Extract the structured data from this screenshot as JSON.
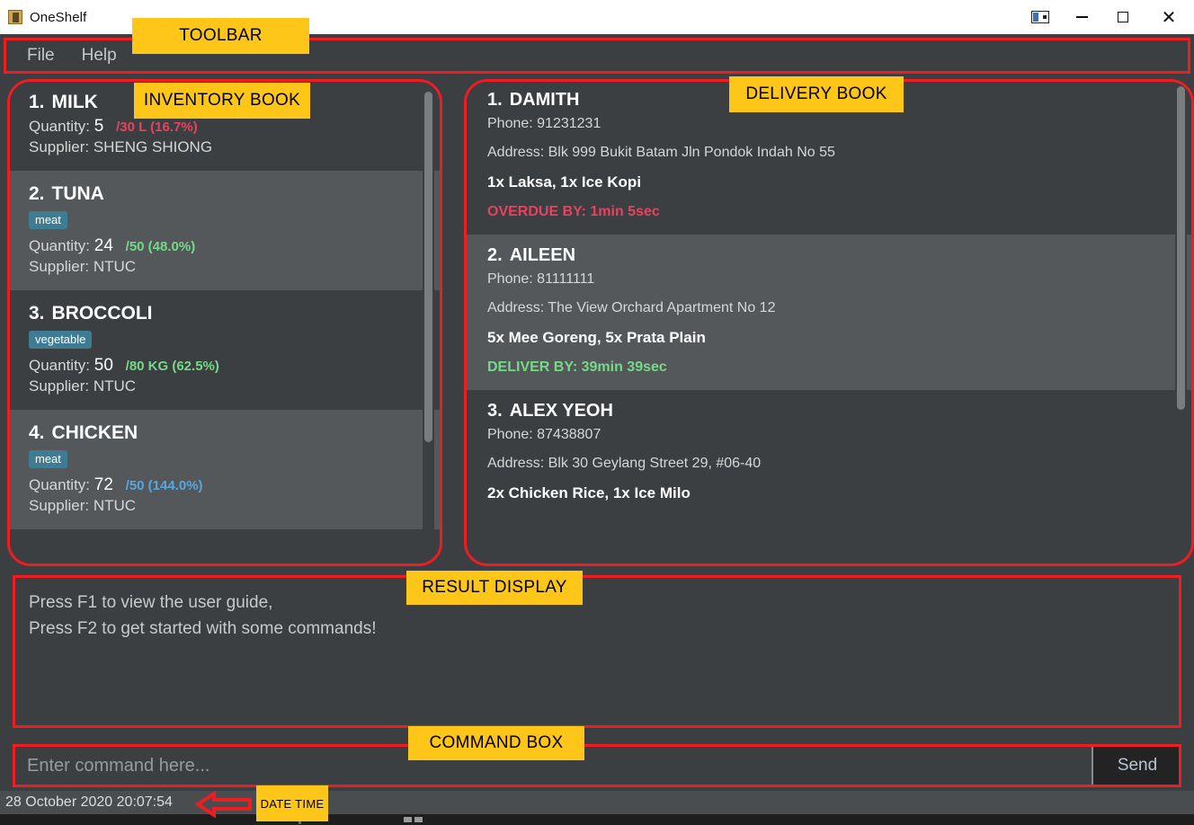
{
  "window": {
    "title": "OneShelf",
    "icon": "app-icon",
    "controls": {
      "panel": "panel-layout-icon",
      "minimize": "minimize-icon",
      "maximize": "maximize-icon",
      "close": "close-icon"
    }
  },
  "menubar": {
    "items": [
      {
        "label": "File"
      },
      {
        "label": "Help"
      }
    ]
  },
  "inventory": {
    "items": [
      {
        "index": "1.",
        "name": "MILK",
        "tag": null,
        "quantity_label": "Quantity:",
        "quantity": "5",
        "ratio": "/30 L (16.7%)",
        "ratio_color": "#e8425e",
        "supplier": "Supplier: SHENG SHIONG"
      },
      {
        "index": "2.",
        "name": "TUNA",
        "tag": "meat",
        "quantity_label": "Quantity:",
        "quantity": "24",
        "ratio": "/50 (48.0%)",
        "ratio_color": "#76d987",
        "supplier": "Supplier: NTUC"
      },
      {
        "index": "3.",
        "name": "BROCCOLI",
        "tag": "vegetable",
        "quantity_label": "Quantity:",
        "quantity": "50",
        "ratio": "/80 KG (62.5%)",
        "ratio_color": "#76d987",
        "supplier": "Supplier: NTUC"
      },
      {
        "index": "4.",
        "name": "CHICKEN",
        "tag": "meat",
        "quantity_label": "Quantity:",
        "quantity": "72",
        "ratio": "/50 (144.0%)",
        "ratio_color": "#56a7e0",
        "supplier": "Supplier: NTUC"
      }
    ]
  },
  "delivery": {
    "items": [
      {
        "index": "1.",
        "name": "DAMITH",
        "phone": "Phone: 91231231",
        "address": "Address: Blk 999 Bukit Batam Jln Pondok Indah No 55",
        "order": "1x Laksa, 1x Ice Kopi",
        "status": "OVERDUE BY: 1min 5sec",
        "status_color": "#e8425e"
      },
      {
        "index": "2.",
        "name": "AILEEN",
        "phone": "Phone: 81111111",
        "address": "Address: The View Orchard Apartment No 12",
        "order": "5x Mee Goreng, 5x Prata Plain",
        "status": "DELIVER BY: 39min 39sec",
        "status_color": "#76d987"
      },
      {
        "index": "3.",
        "name": "ALEX YEOH",
        "phone": "Phone: 87438807",
        "address": "Address: Blk 30 Geylang Street 29, #06-40",
        "order": "2x Chicken Rice, 1x Ice Milo",
        "status": "",
        "status_color": "#76d987"
      }
    ]
  },
  "result": {
    "line1": "Press F1 to view the user guide,",
    "line2": "Press F2 to get started with some commands!"
  },
  "command": {
    "placeholder": "Enter command here...",
    "value": "",
    "send_label": "Send"
  },
  "status": {
    "datetime": "28 October 2020 20:07:54"
  },
  "annotations": {
    "toolbar": "TOOLBAR",
    "inventory_book": "INVENTORY BOOK",
    "delivery_book": "DELIVERY BOOK",
    "result_display": "RESULT DISPLAY",
    "command_box": "COMMAND BOX",
    "date_time": "DATE TIME",
    "accent_color": "#ef1c22",
    "label_color": "#ffc61a"
  }
}
